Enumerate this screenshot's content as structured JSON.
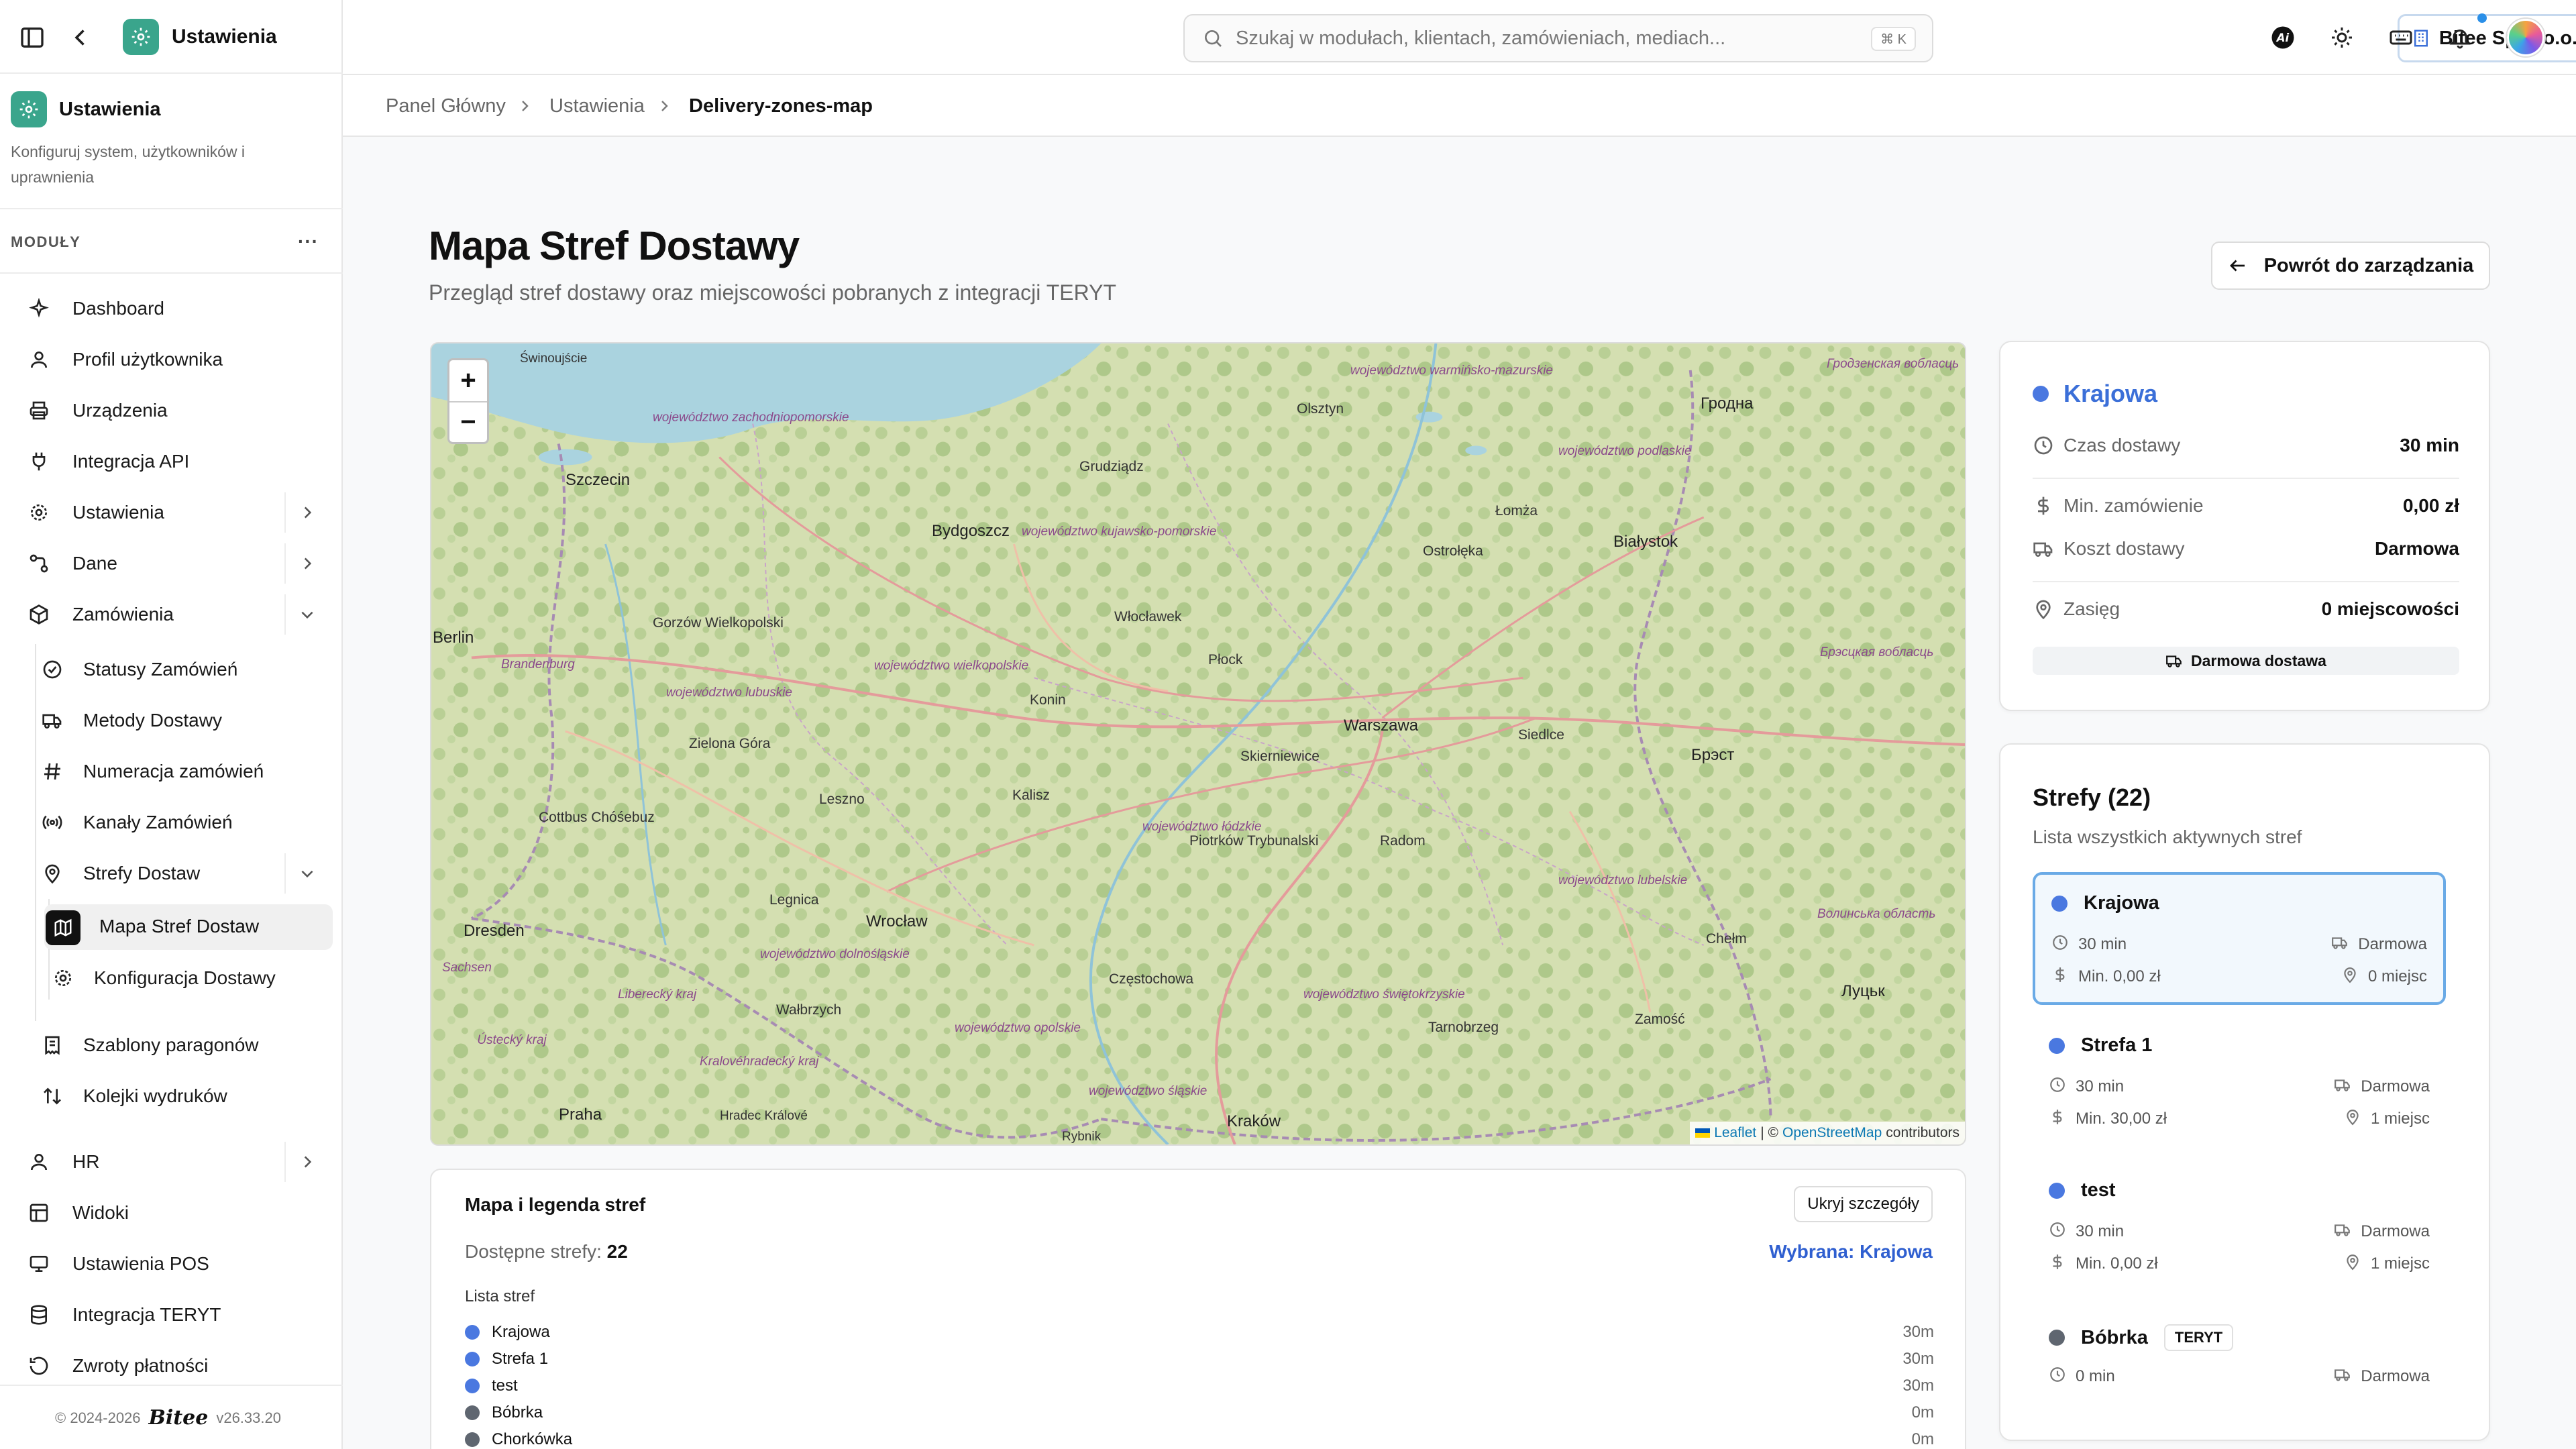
{
  "app": {
    "title": "Ustawienia",
    "section_title": "Ustawienia",
    "section_desc": "Konfiguruj system, użytkowników i uprawnienia",
    "modules_label": "MODUŁY"
  },
  "sidebar": {
    "items": [
      {
        "label": "Dashboard",
        "icon": "sparkle-icon"
      },
      {
        "label": "Profil użytkownika",
        "icon": "user-icon"
      },
      {
        "label": "Urządzenia",
        "icon": "printer-icon"
      },
      {
        "label": "Integracja API",
        "icon": "plug-icon"
      },
      {
        "label": "Ustawienia",
        "icon": "gear-icon"
      },
      {
        "label": "Dane",
        "icon": "data-icon"
      },
      {
        "label": "Zamówienia",
        "icon": "package-icon"
      },
      {
        "label": "Statusy Zamówień",
        "icon": "check-circle-icon"
      },
      {
        "label": "Metody Dostawy",
        "icon": "truck-icon"
      },
      {
        "label": "Numeracja zamówień",
        "icon": "hash-icon"
      },
      {
        "label": "Kanały Zamówień",
        "icon": "broadcast-icon"
      },
      {
        "label": "Strefy Dostaw",
        "icon": "map-pin-icon"
      },
      {
        "label": "Mapa Stref Dostaw",
        "icon": "map-icon"
      },
      {
        "label": "Konfiguracja Dostawy",
        "icon": "gear-icon"
      },
      {
        "label": "Szablony paragonów",
        "icon": "receipt-icon"
      },
      {
        "label": "Kolejki wydruków",
        "icon": "sort-icon"
      },
      {
        "label": "HR",
        "icon": "user-icon"
      },
      {
        "label": "Widoki",
        "icon": "layout-icon"
      },
      {
        "label": "Ustawienia POS",
        "icon": "monitor-icon"
      },
      {
        "label": "Integracja TERYT",
        "icon": "database-icon"
      },
      {
        "label": "Zwroty płatności",
        "icon": "refund-icon"
      }
    ],
    "footer_copy": "© 2024-2026",
    "footer_brand": "Bitee",
    "footer_version": "v26.33.20"
  },
  "header": {
    "search_placeholder": "Szukaj w modułach, klientach, zamówieniach, mediach...",
    "search_shortcut": "⌘ K",
    "company": "Bitee Sp. z o.o.",
    "ai_label": "Ai"
  },
  "breadcrumb": [
    "Panel Główny",
    "Ustawienia",
    "Delivery-zones-map"
  ],
  "page": {
    "title": "Mapa Stref Dostawy",
    "subtitle": "Przegląd stref dostawy oraz miejscowości pobranych z integracji TERYT",
    "back_button": "Powrót do zarządzania"
  },
  "map": {
    "zoom_in": "+",
    "zoom_out": "−",
    "attribution_leaflet": "Leaflet",
    "attribution_sep": "| ©",
    "attribution_osm": "OpenStreetMap",
    "attribution_tail": "contributors",
    "labels": [
      "Świnoujście",
      "Szczecin",
      "Berlin",
      "Brandenburg",
      "Gorzów Wielkopolski",
      "Zielona Góra",
      "Cottbus Chóśebuz",
      "Dresden",
      "Sachsen",
      "Legnica",
      "Wrocław",
      "Wałbrzych",
      "Liberecký kraj",
      "Ústecký kraj",
      "Praha",
      "Hradec Králové",
      "Kralovéhradecký kraj",
      "Bydgoszcz",
      "Grudziądz",
      "Olsztyn",
      "Włocławek",
      "Płock",
      "Konin",
      "Leszno",
      "Kalisz",
      "Skierniewice",
      "Warszawa",
      "Łomża",
      "Białystok",
      "Ostrołęka",
      "Siedlce",
      "Piotrków Trybunalski",
      "Radom",
      "Częstochowa",
      "Kraków",
      "Rybnik",
      "Tarnobrzeg",
      "Zamość",
      "Chełm",
      "Гродна",
      "Брэст",
      "Луцьк",
      "Гродзенская вобласць",
      "Брэсцкая вобласць",
      "Волинська область",
      "województwo zachodniopomorskie",
      "województwo kujawsko-pomorskie",
      "województwo warmińsko-mazurskie",
      "województwo podlaskie",
      "województwo wielkopolskie",
      "województwo lubuskie",
      "województwo łódzkie",
      "województwo dolnośląskie",
      "województwo opolskie",
      "województwo śląskie",
      "województwo świętokrzyskie",
      "województwo lubelskie"
    ]
  },
  "legend": {
    "title": "Mapa i legenda stref",
    "toggle": "Ukryj szczegóły",
    "available_label": "Dostępne strefy:",
    "available_count": "22",
    "selected": "Wybrana: Krajowa",
    "list_header": "Lista stref",
    "rows": [
      {
        "name": "Krajowa",
        "time": "30m",
        "color": "#4a78e0"
      },
      {
        "name": "Strefa 1",
        "time": "30m",
        "color": "#4a78e0"
      },
      {
        "name": "test",
        "time": "30m",
        "color": "#4a78e0"
      },
      {
        "name": "Bóbrka",
        "time": "0m",
        "color": "#5f6670"
      },
      {
        "name": "Chorkówka",
        "time": "0m",
        "color": "#5f6670"
      }
    ]
  },
  "selected_zone": {
    "name": "Krajowa",
    "rows": [
      {
        "label": "Czas dostawy",
        "value": "30 min"
      },
      {
        "label": "Min. zamówienie",
        "value": "0,00 zł"
      },
      {
        "label": "Koszt dostawy",
        "value": "Darmowa"
      },
      {
        "label": "Zasięg",
        "value": "0 miejscowości"
      }
    ],
    "badge": "Darmowa dostawa"
  },
  "zones": {
    "title": "Strefy (22)",
    "subtitle": "Lista wszystkich aktywnych stref",
    "items": [
      {
        "name": "Krajowa",
        "time": "30 min",
        "cost": "Darmowa",
        "min": "Min. 0,00 zł",
        "places": "0 miejsc",
        "tag": "",
        "color": "#4a78e0"
      },
      {
        "name": "Strefa 1",
        "time": "30 min",
        "cost": "Darmowa",
        "min": "Min. 30,00 zł",
        "places": "1 miejsc",
        "tag": "",
        "color": "#4a78e0"
      },
      {
        "name": "test",
        "time": "30 min",
        "cost": "Darmowa",
        "min": "Min. 0,00 zł",
        "places": "1 miejsc",
        "tag": "",
        "color": "#4a78e0"
      },
      {
        "name": "Bóbrka",
        "time": "0 min",
        "cost": "Darmowa",
        "min": "",
        "places": "",
        "tag": "TERYT",
        "color": "#5f6670"
      }
    ]
  },
  "colors": {
    "accent": "#3aa58c",
    "zone_blue": "#4a78e0",
    "zone_gray": "#5f6670",
    "selected_border": "#6aaae6"
  }
}
